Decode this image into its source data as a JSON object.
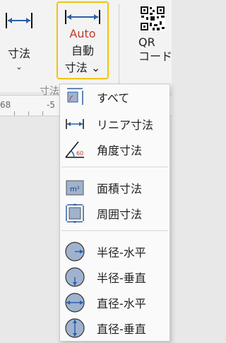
{
  "ribbon": {
    "dimension": {
      "label": "寸法",
      "chevron": "⌄"
    },
    "auto_dimension": {
      "auto_text": "Auto",
      "label_line1": "自動",
      "label_line2": "寸法 ⌄"
    },
    "qr": {
      "label_line1": "QR",
      "label_line2": "コード"
    },
    "group_caption": "寸法"
  },
  "ruler": {
    "numbers": [
      "68",
      "-5"
    ]
  },
  "menu": {
    "items": [
      {
        "label": "すべて",
        "icon": "all-dimensions-icon"
      },
      {
        "label": "リニア寸法",
        "icon": "linear-dimension-icon"
      },
      {
        "label": "角度寸法",
        "icon": "angle-dimension-icon"
      },
      {
        "label": "面積寸法",
        "icon": "area-dimension-icon"
      },
      {
        "label": "周囲寸法",
        "icon": "perimeter-dimension-icon"
      },
      {
        "label": "半径-水平",
        "icon": "radius-horizontal-icon"
      },
      {
        "label": "半径-垂直",
        "icon": "radius-vertical-icon"
      },
      {
        "label": "直径-水平",
        "icon": "diameter-horizontal-icon"
      },
      {
        "label": "直径-垂直",
        "icon": "diameter-vertical-icon"
      }
    ],
    "angle_icon_text": "60",
    "area_icon_text": "m²"
  },
  "colors": {
    "accent_blue": "#2e5fa8",
    "auto_red": "#c0392b",
    "highlight_yellow": "#f1c40f"
  }
}
